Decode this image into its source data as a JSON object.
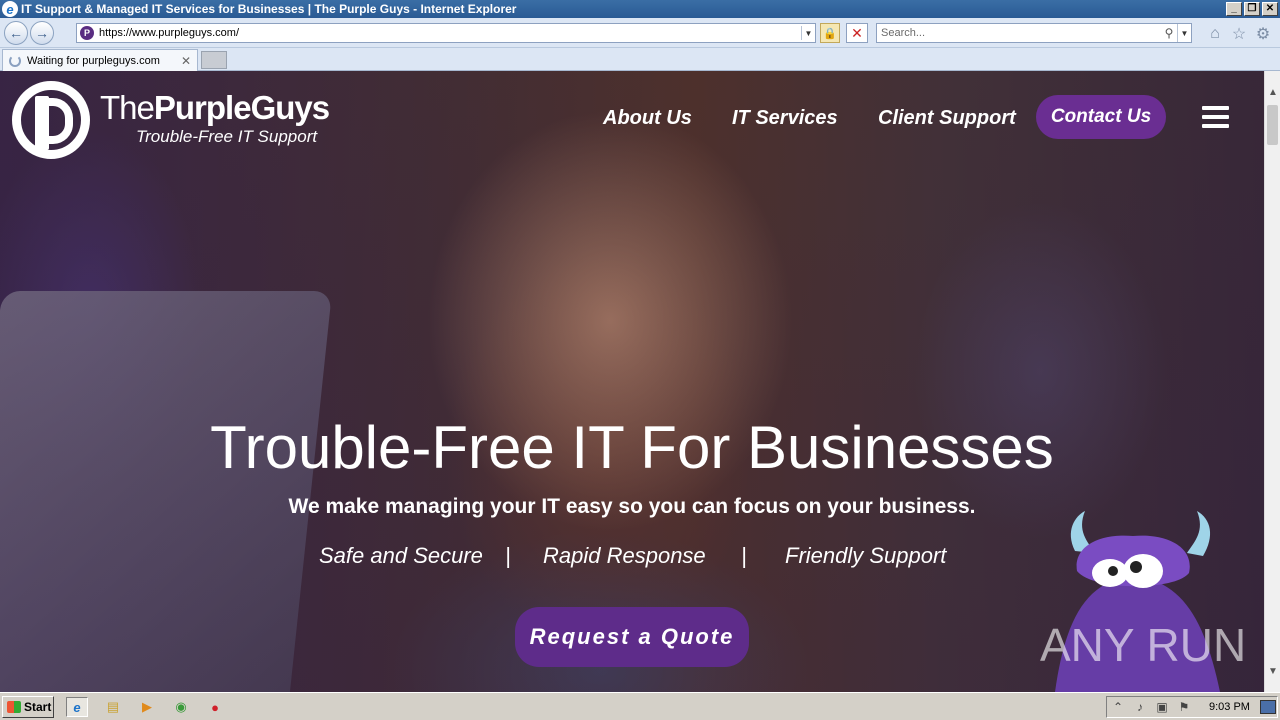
{
  "window": {
    "title": "IT Support & Managed IT Services for Businesses | The Purple Guys - Internet Explorer",
    "controls": [
      "_",
      "❐",
      "✕"
    ]
  },
  "browser": {
    "url": "https://www.purpleguys.com/",
    "search_placeholder": "Search...",
    "tab_label": "Waiting for purpleguys.com"
  },
  "site": {
    "logo_name_light": "The",
    "logo_name_bold": "PurpleGuys",
    "logo_tagline": "Trouble-Free IT Support",
    "nav": {
      "about": "About Us",
      "services": "IT Services",
      "support": "Client Support",
      "contact": "Contact Us"
    },
    "hero": {
      "title": "Trouble-Free IT For Businesses",
      "subtitle": "We make managing your IT easy so you can focus on your business.",
      "features": [
        "Safe and Secure",
        "|",
        "Rapid Response",
        "|",
        "Friendly Support"
      ],
      "cta": "Request a Quote"
    },
    "accent_color": "#6a2e92"
  },
  "watermark": {
    "text": "ANY RUN"
  },
  "taskbar": {
    "start_label": "Start",
    "clock": "9:03 PM"
  }
}
